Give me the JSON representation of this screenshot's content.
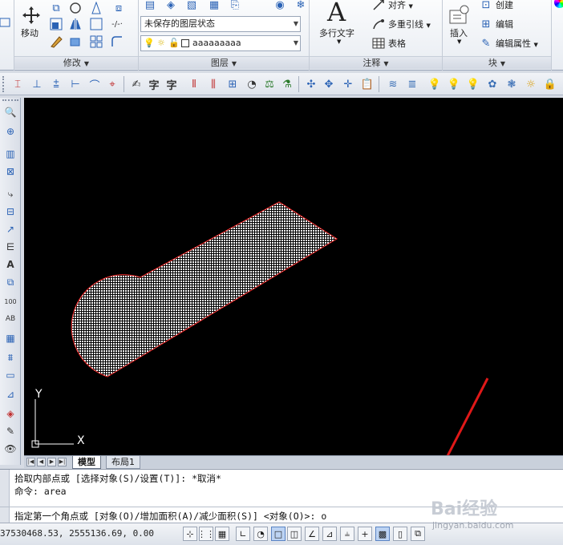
{
  "ribbon": {
    "modify": {
      "move_label": "移动",
      "title": "修改"
    },
    "layers": {
      "state_combo": "未保存的图层状态",
      "layer_combo": "aaaaaaaaa",
      "title": "图层"
    },
    "annotation": {
      "mtext_label": "多行文字",
      "align_label": "对齐",
      "mleader_label": "多重引线",
      "table_label": "表格",
      "title": "注释"
    },
    "block": {
      "insert_label": "插入",
      "create_label": "创建",
      "edit_label": "编辑",
      "edit_attr_label": "编辑属性",
      "title": "块"
    }
  },
  "drawing": {
    "ucs_x_label": "X",
    "ucs_y_label": "Y",
    "fill_color": "#ffffff",
    "boundary_color": "#ff3030"
  },
  "tabs": {
    "model": "模型",
    "layout1": "布局1"
  },
  "command": {
    "line1": "拾取内部点或 [选择对象(S)/设置(T)]: *取消*",
    "line2": "命令: area",
    "prompt": "指定第一个角点或 [对象(O)/增加面积(A)/减少面积(S)] <对象(O)>: o"
  },
  "status": {
    "coords": "37530468.53, 2555136.69, 0.00"
  },
  "watermark": {
    "text": "Bai经验",
    "url": "jingyan.baidu.com"
  }
}
